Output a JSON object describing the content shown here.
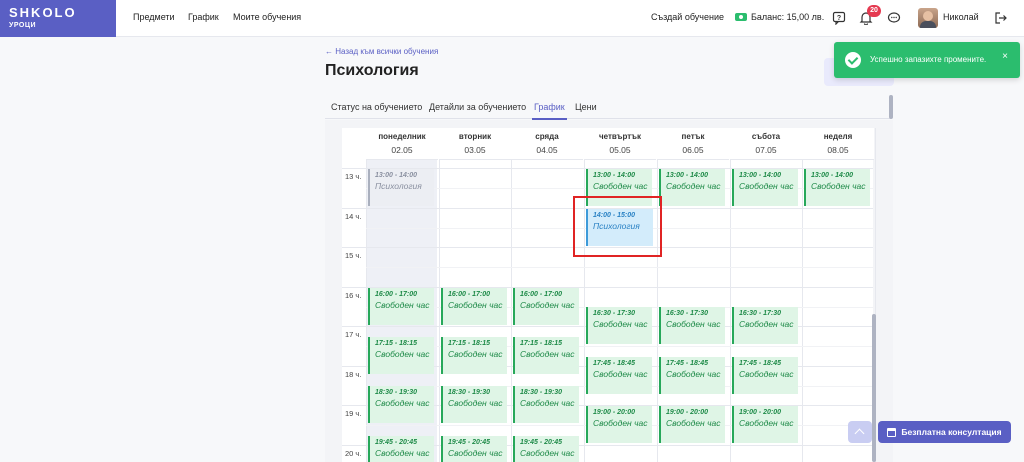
{
  "logo": {
    "main": "SHKOLO",
    "sub": "УРОЦИ"
  },
  "nav": [
    {
      "id": "subjects",
      "label": "Предмети"
    },
    {
      "id": "schedule",
      "label": "График"
    },
    {
      "id": "my-courses",
      "label": "Моите обучения"
    }
  ],
  "header": {
    "create_label": "Създай обучение",
    "balance_label": "Баланс: 15,00 лв.",
    "notification_count": "20",
    "user_name": "Николай"
  },
  "page": {
    "back_link": "← Назад към всички обучения",
    "title": "Психология"
  },
  "tabs": [
    {
      "label": "Статус на обучението",
      "active": false
    },
    {
      "label": "Детайли за обучението",
      "active": false
    },
    {
      "label": "График",
      "active": true
    },
    {
      "label": "Цени",
      "active": false
    }
  ],
  "calendar": {
    "days": [
      {
        "name": "понеделник",
        "date": "02.05"
      },
      {
        "name": "вторник",
        "date": "03.05"
      },
      {
        "name": "сряда",
        "date": "04.05"
      },
      {
        "name": "четвъртък",
        "date": "05.05"
      },
      {
        "name": "петък",
        "date": "06.05"
      },
      {
        "name": "събота",
        "date": "07.05"
      },
      {
        "name": "неделя",
        "date": "08.05"
      }
    ],
    "hours": [
      "13 ч.",
      "14 ч.",
      "15 ч.",
      "16 ч.",
      "17 ч.",
      "18 ч.",
      "19 ч.",
      "20 ч."
    ],
    "free_label": "Свободен час",
    "events": [
      {
        "day": 0,
        "start": 13,
        "time": "13:00 - 14:00",
        "label": "Психология",
        "kind": "past"
      },
      {
        "day": 3,
        "start": 13,
        "time": "13:00 - 14:00",
        "label": "Свободен час",
        "kind": "free"
      },
      {
        "day": 4,
        "start": 13,
        "time": "13:00 - 14:00",
        "label": "Свободен час",
        "kind": "free"
      },
      {
        "day": 5,
        "start": 13,
        "time": "13:00 - 14:00",
        "label": "Свободен час",
        "kind": "free"
      },
      {
        "day": 6,
        "start": 13,
        "time": "13:00 - 14:00",
        "label": "Свободен час",
        "kind": "free"
      },
      {
        "day": 3,
        "start": 14,
        "time": "14:00 - 15:00",
        "label": "Психология",
        "kind": "booked"
      },
      {
        "day": 0,
        "start": 16,
        "time": "16:00 - 17:00",
        "label": "Свободен час",
        "kind": "free"
      },
      {
        "day": 1,
        "start": 16,
        "time": "16:00 - 17:00",
        "label": "Свободен час",
        "kind": "free"
      },
      {
        "day": 2,
        "start": 16,
        "time": "16:00 - 17:00",
        "label": "Свободен час",
        "kind": "free"
      },
      {
        "day": 3,
        "start": 16.5,
        "time": "16:30 - 17:30",
        "label": "Свободен час",
        "kind": "free"
      },
      {
        "day": 4,
        "start": 16.5,
        "time": "16:30 - 17:30",
        "label": "Свободен час",
        "kind": "free"
      },
      {
        "day": 5,
        "start": 16.5,
        "time": "16:30 - 17:30",
        "label": "Свободен час",
        "kind": "free"
      },
      {
        "day": 0,
        "start": 17.25,
        "time": "17:15 - 18:15",
        "label": "Свободен час",
        "kind": "free"
      },
      {
        "day": 1,
        "start": 17.25,
        "time": "17:15 - 18:15",
        "label": "Свободен час",
        "kind": "free"
      },
      {
        "day": 2,
        "start": 17.25,
        "time": "17:15 - 18:15",
        "label": "Свободен час",
        "kind": "free"
      },
      {
        "day": 3,
        "start": 17.75,
        "time": "17:45 - 18:45",
        "label": "Свободен час",
        "kind": "free"
      },
      {
        "day": 4,
        "start": 17.75,
        "time": "17:45 - 18:45",
        "label": "Свободен час",
        "kind": "free"
      },
      {
        "day": 5,
        "start": 17.75,
        "time": "17:45 - 18:45",
        "label": "Свободен час",
        "kind": "free"
      },
      {
        "day": 0,
        "start": 18.5,
        "time": "18:30 - 19:30",
        "label": "Свободен час",
        "kind": "free"
      },
      {
        "day": 1,
        "start": 18.5,
        "time": "18:30 - 19:30",
        "label": "Свободен час",
        "kind": "free"
      },
      {
        "day": 2,
        "start": 18.5,
        "time": "18:30 - 19:30",
        "label": "Свободен час",
        "kind": "free"
      },
      {
        "day": 3,
        "start": 19,
        "time": "19:00 - 20:00",
        "label": "Свободен час",
        "kind": "free"
      },
      {
        "day": 4,
        "start": 19,
        "time": "19:00 - 20:00",
        "label": "Свободен час",
        "kind": "free"
      },
      {
        "day": 5,
        "start": 19,
        "time": "19:00 - 20:00",
        "label": "Свободен час",
        "kind": "free"
      },
      {
        "day": 0,
        "start": 19.75,
        "time": "19:45 - 20:45",
        "label": "Свободен час",
        "kind": "free"
      },
      {
        "day": 1,
        "start": 19.75,
        "time": "19:45 - 20:45",
        "label": "Свободен час",
        "kind": "free"
      },
      {
        "day": 2,
        "start": 19.75,
        "time": "19:45 - 20:45",
        "label": "Свободен час",
        "kind": "free"
      }
    ]
  },
  "toast": {
    "message": "Успешно запазихте промените.",
    "close": "×"
  },
  "consult_button": "Безплатна консултация",
  "colors": {
    "brand": "#5a5fc4",
    "success": "#2bbd6e",
    "free_slot": "#dff5e6",
    "booked_slot": "#d3ecfb",
    "highlight": "#e02424"
  }
}
